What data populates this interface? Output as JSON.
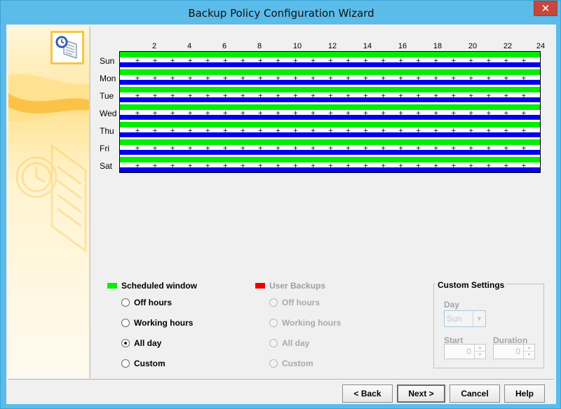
{
  "window": {
    "title": "Backup Policy Configuration Wizard",
    "close_glyph": "✕"
  },
  "schedule": {
    "hour_ticks": [
      "2",
      "4",
      "6",
      "8",
      "10",
      "12",
      "14",
      "16",
      "18",
      "20",
      "22",
      "24"
    ],
    "days": [
      "Sun",
      "Mon",
      "Tue",
      "Wed",
      "Thu",
      "Fri",
      "Sat"
    ],
    "tick_mark": "+",
    "colors": {
      "scheduled": "#00ee00",
      "user": "#0000ee",
      "background": "#ffffff"
    }
  },
  "scheduled_window": {
    "label": "Scheduled window",
    "color": "#00ee00",
    "options": [
      {
        "label": "Off hours",
        "selected": false
      },
      {
        "label": "Working hours",
        "selected": false
      },
      {
        "label": "All day",
        "selected": true
      },
      {
        "label": "Custom",
        "selected": false
      }
    ]
  },
  "user_backups": {
    "label": "User Backups",
    "color": "#ee0000",
    "options": [
      {
        "label": "Off hours",
        "selected": false
      },
      {
        "label": "Working hours",
        "selected": false
      },
      {
        "label": "All day",
        "selected": false
      },
      {
        "label": "Custom",
        "selected": false
      }
    ]
  },
  "custom_settings": {
    "title": "Custom Settings",
    "day_label": "Day",
    "day_value": "Sun",
    "start_label": "Start",
    "start_value": "0",
    "duration_label": "Duration",
    "duration_value": "0"
  },
  "buttons": {
    "back": "< Back",
    "next": "Next >",
    "cancel": "Cancel",
    "help": "Help"
  },
  "icons": {
    "wizard": "backup-wizard-icon",
    "dropdown": "chevron-down-icon"
  }
}
